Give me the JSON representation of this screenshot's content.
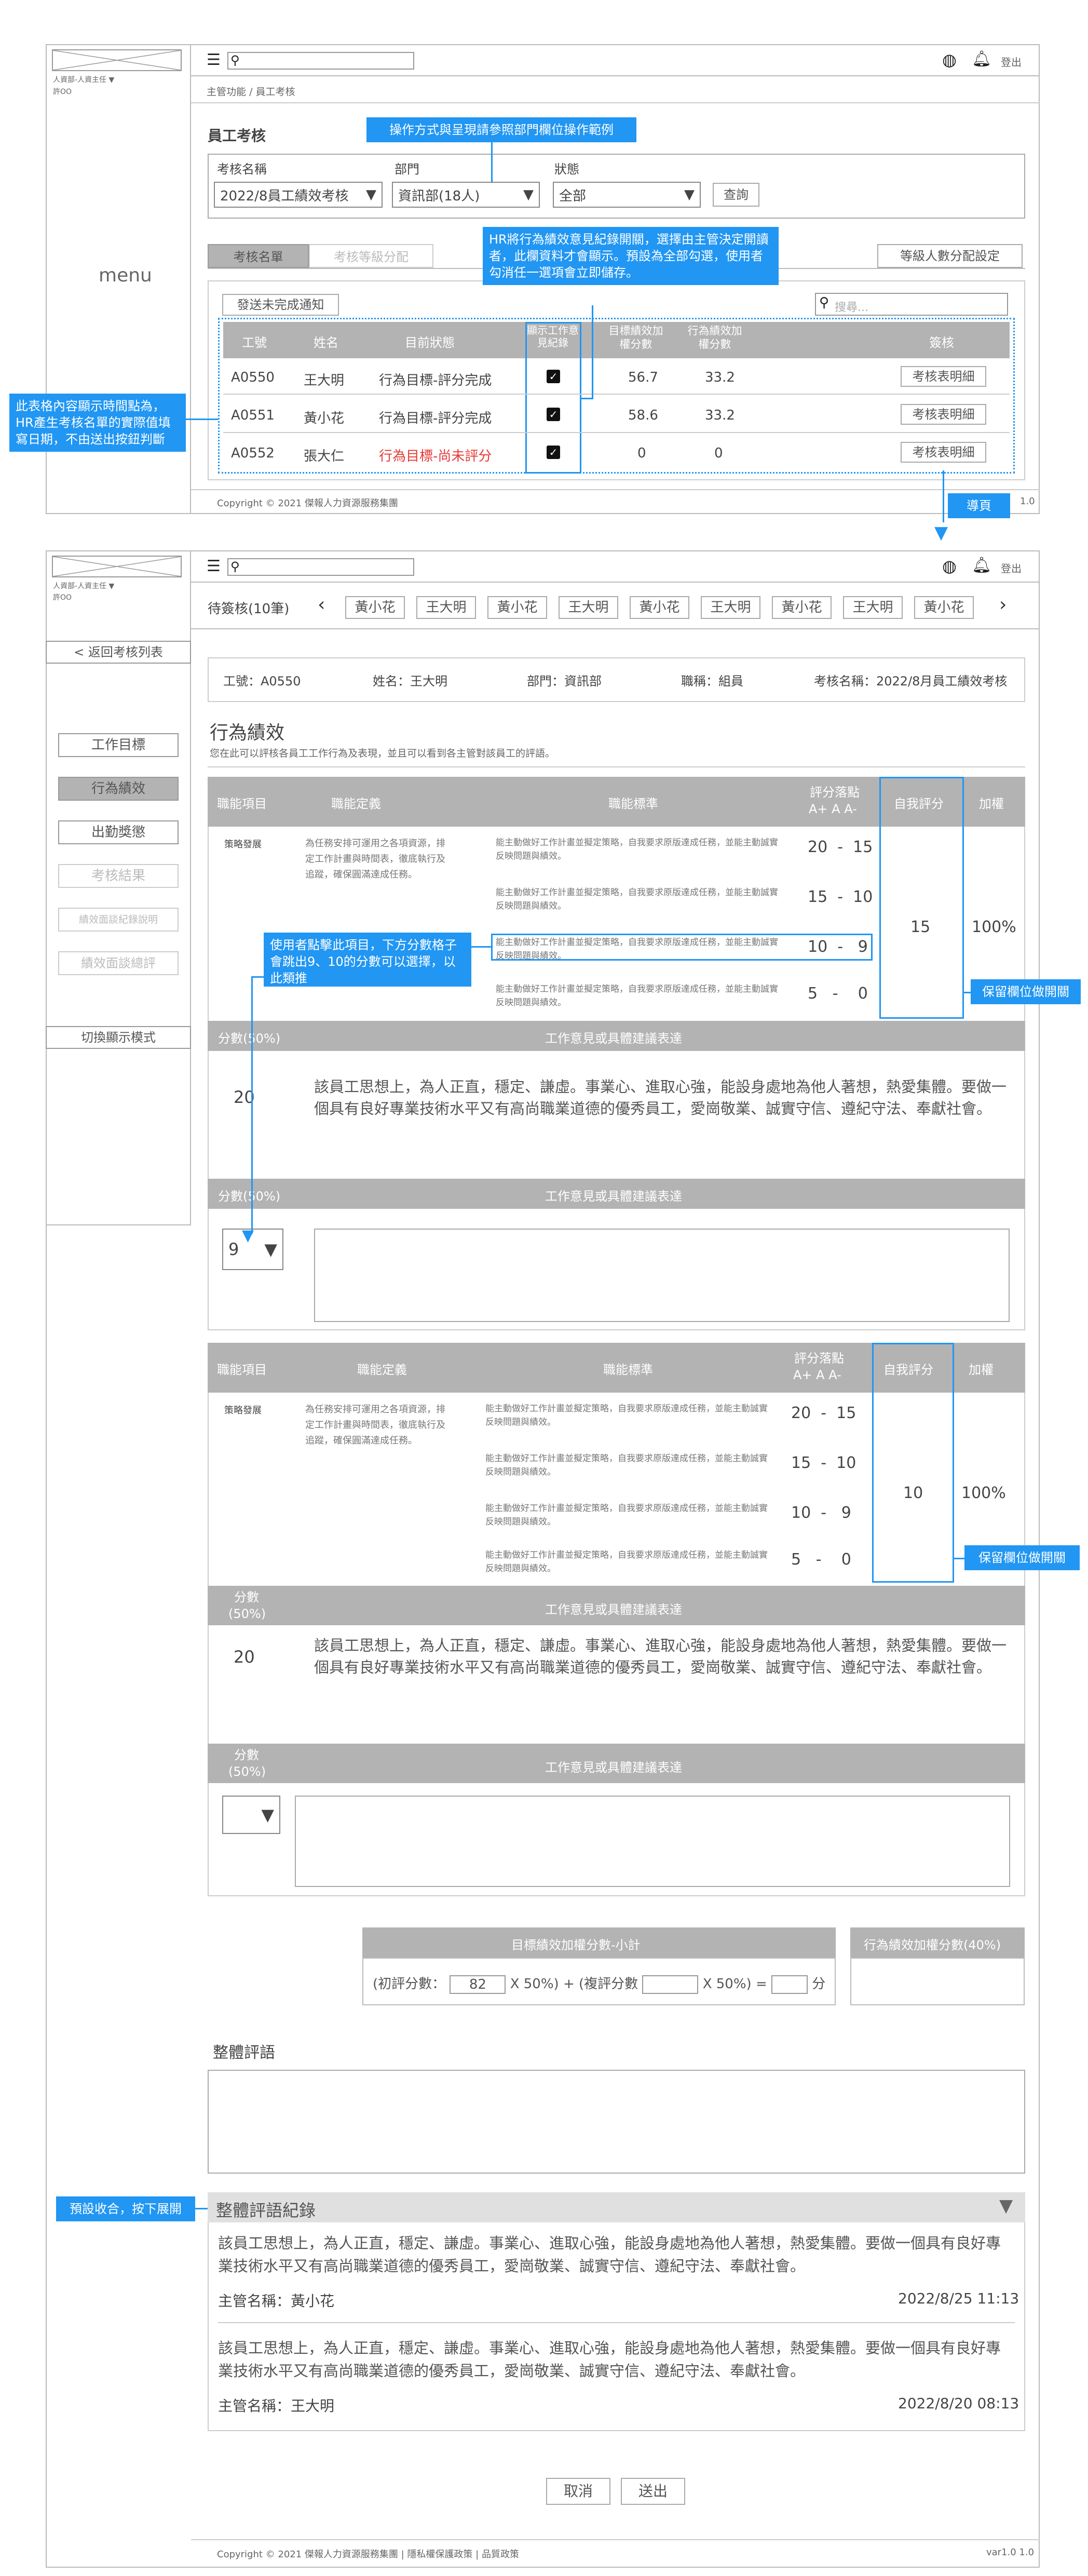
{
  "brand": {
    "logo": "LOGO",
    "role": "人資部-人資主任",
    "menu_arrow": "▼"
  },
  "header": {
    "logout": "登出"
  },
  "breadcrumb": {
    "a": "主管功能",
    "sep": "/",
    "b": "員工考核"
  },
  "s1": {
    "page_title": "員工考核",
    "filters": {
      "name_label": "考核名稱",
      "name_value": "2022/8員工績效考核",
      "dept_label": "部門",
      "dept_value": "資訊部(18人)",
      "status_label": "狀態",
      "status_value": "全部",
      "query": "查詢"
    },
    "tabs": [
      "考核名單",
      "考核等級分配"
    ],
    "grade_btn": "等級人數分配設定",
    "notify_btn": "發送未完成通知",
    "search_placeholder": "搜尋...",
    "columns": [
      "工號",
      "姓名",
      "目前狀態",
      "顯示工作意見紀錄",
      "目標績效加權分數",
      "行為績效加權分數",
      "簽核"
    ],
    "rows": [
      {
        "id": "A0550",
        "name": "王大明",
        "status": "行為目標-評分完成",
        "a": "56.7",
        "b": "33.2",
        "action": "考核表明細",
        "red": false
      },
      {
        "id": "A0551",
        "name": "黃小花",
        "status": "行為目標-評分完成",
        "a": "58.6",
        "b": "33.2",
        "action": "考核表明細",
        "red": false
      },
      {
        "id": "A0552",
        "name": "張大仁",
        "status": "行為目標-尚未評分",
        "a": "0",
        "b": "0",
        "action": "考核表明細",
        "red": true
      }
    ],
    "menu": "menu",
    "footer": "Copyright © 2021 傑報人力資源服務集團",
    "version": "1.0"
  },
  "notes": {
    "n1": "操作方式與呈現請參照部門欄位操作範例",
    "n2": "HR將行為績效意見紀錄開關，選擇由主管決定開讀者，此欄資料才會顯示。預設為全部勾選，使用者勾消任一選項會立即儲存。",
    "n3": "此表格內容顯示時間點為，HR產生考核名單的實際值填寫日期，不由送出按鈕判斷",
    "n4": "導頁",
    "n5": "使用者點擊此項目，下方分數格子會跳出9、10的分數可以選擇，以此類推",
    "n6": "保留欄位做開關",
    "n7": "保留欄位做開關",
    "n8": "預設收合，按下展開"
  },
  "s2": {
    "pending": "待簽核(10筆)",
    "people": [
      "黃小花",
      "王大明",
      "黃小花",
      "王大明",
      "黃小花",
      "王大明",
      "黃小花",
      "王大明",
      "黃小花"
    ],
    "back": "< 返回考核列表",
    "side": [
      "工作目標",
      "行為績效",
      "出勤獎懲",
      "考核結果",
      "績效面談紀錄說明",
      "績效面談總評",
      "切換顯示模式"
    ],
    "info": {
      "id": "工號：A0550",
      "name": "姓名：王大明",
      "dept": "部門：資訊部",
      "title": "職稱：組員",
      "exam": "考核名稱：2022/8月員工績效考核"
    },
    "section_title": "行為績效",
    "section_desc": "您在此可以評核各員工工作行為及表現，並且可以看到各主管對該員工的評語。",
    "thead": [
      "職能項目",
      "職能定義",
      "職能標準",
      "評分落點",
      "A+ A A-",
      "自我評分",
      "加權"
    ],
    "blocks": [
      {
        "item": "策略發展",
        "def": "為任務安排可運用之各項資源，排定工作計畫與時間表，徹底執行及追蹤，確保圓滿達成任務。",
        "crit": "能主動做好工作計畫並擬定策略，自我要求原版達成任務，並能主動誠實反映問題與績效。",
        "ranges": [
          [
            "20",
            "-",
            "15"
          ],
          [
            "15",
            "-",
            "10"
          ],
          [
            "10",
            "-",
            "9"
          ],
          [
            "5",
            "-",
            "0"
          ]
        ],
        "self": "15",
        "weight": "100%",
        "score_label": "分數(50%)",
        "comment_head": "工作意見或具體建議表達",
        "score": "20",
        "comment": "該員工思想上，為人正直，穩定、謙虛。事業心、進取心強，能設身處地為他人著想，熱愛集體。要做一個具有良好專業技術水平又有高尚職業道德的優秀員工，愛崗敬業、誠實守信、遵紀守法、奉獻社會。",
        "select": "9"
      },
      {
        "item": "策略發展",
        "def": "為任務安排可運用之各項資源，排定工作計畫與時間表，徹底執行及追蹤，確保圓滿達成任務。",
        "crit": "能主動做好工作計畫並擬定策略，自我要求原版達成任務，並能主動誠實反映問題與績效。",
        "ranges": [
          [
            "20",
            "-",
            "15"
          ],
          [
            "15",
            "-",
            "10"
          ],
          [
            "10",
            "-",
            "9"
          ],
          [
            "5",
            "-",
            "0"
          ]
        ],
        "self": "10",
        "weight": "100%",
        "score_label": "分數(50%)",
        "comment_head": "工作意見或具體建議表達",
        "score": "20",
        "comment": "該員工思想上，為人正直，穩定、謙虛。事業心、進取心強，能設身處地為他人著想，熱愛集體。要做一個具有良好專業技術水平又有高尚職業道德的優秀員工，愛崗敬業、誠實守信、遵紀守法、奉獻社會。",
        "select": ""
      }
    ],
    "subtotal": {
      "head": "目標績效加權分數-小計",
      "formula_a": "(初評分數：",
      "val": "82",
      "formula_b": "X 50%) + (複評分數",
      "formula_c": "X 50%) =",
      "formula_d": "分",
      "head2": "行為績效加權分數(40%)"
    },
    "overall_label": "整體評語",
    "history_title": "整體評語紀錄",
    "history": [
      {
        "text": "該員工思想上，為人正直，穩定、謙虛。事業心、進取心強，能設身處地為他人著想，熱愛集體。要做一個具有良好專業技術水平又有高尚職業道德的優秀員工，愛崗敬業、誠實守信、遵紀守法、奉獻社會。",
        "who": "主管名稱：黃小花",
        "when": "2022/8/25 11:13"
      },
      {
        "text": "該員工思想上，為人正直，穩定、謙虛。事業心、進取心強，能設身處地為他人著想，熱愛集體。要做一個具有良好專業技術水平又有高尚職業道德的優秀員工，愛崗敬業、誠實守信、遵紀守法、奉獻社會。",
        "who": "主管名稱：王大明",
        "when": "2022/8/20 08:13"
      }
    ],
    "cancel": "取消",
    "submit": "送出",
    "footer": "Copyright © 2021 傑報人力資源服務集團 | 隱私權保護政策 | 品質政策",
    "version": "var1.0 1.0"
  }
}
